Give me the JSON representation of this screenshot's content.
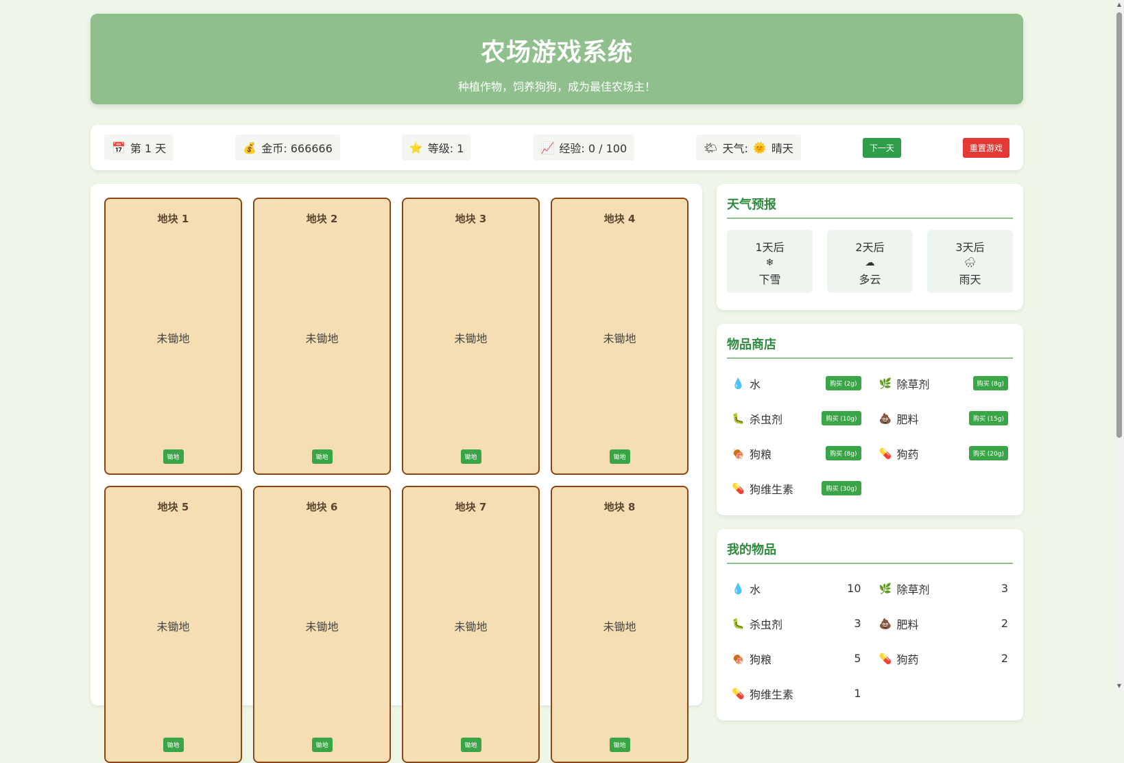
{
  "header": {
    "title": "农场游戏系统",
    "subtitle": "种植作物，饲养狗狗，成为最佳农场主！"
  },
  "status": {
    "day": "第 1 天",
    "gold": "金币: 666666",
    "level": "等级: 1",
    "exp": "经验: 0 / 100",
    "weather_label": "天气:",
    "weather_value": "晴天",
    "next_day_button": "下一天",
    "reset_button": "重置游戏"
  },
  "plots": [
    {
      "title": "地块 1",
      "state": "未锄地",
      "action": "锄地"
    },
    {
      "title": "地块 2",
      "state": "未锄地",
      "action": "锄地"
    },
    {
      "title": "地块 3",
      "state": "未锄地",
      "action": "锄地"
    },
    {
      "title": "地块 4",
      "state": "未锄地",
      "action": "锄地"
    },
    {
      "title": "地块 5",
      "state": "未锄地",
      "action": "锄地"
    },
    {
      "title": "地块 6",
      "state": "未锄地",
      "action": "锄地"
    },
    {
      "title": "地块 7",
      "state": "未锄地",
      "action": "锄地"
    },
    {
      "title": "地块 8",
      "state": "未锄地",
      "action": "锄地"
    }
  ],
  "forecast": {
    "title": "天气预报",
    "days": [
      {
        "when": "1天后",
        "icon": "snowflake-icon",
        "glyph": "❄",
        "label": "下雪"
      },
      {
        "when": "2天后",
        "icon": "cloud-icon",
        "glyph": "☁",
        "label": "多云"
      },
      {
        "when": "3天后",
        "icon": "rain-cloud-icon",
        "glyph": "🌧",
        "label": "雨天"
      }
    ]
  },
  "shop": {
    "title": "物品商店",
    "items": [
      {
        "name": "水",
        "icon": "water-drop-icon",
        "glyph": "💧",
        "buy": "购买 (2g)"
      },
      {
        "name": "除草剂",
        "icon": "herb-icon",
        "glyph": "🌿",
        "buy": "购买 (8g)"
      },
      {
        "name": "杀虫剂",
        "icon": "bug-icon",
        "glyph": "🐛",
        "buy": "购买 (10g)"
      },
      {
        "name": "肥料",
        "icon": "poop-icon",
        "glyph": "💩",
        "buy": "购买 (15g)"
      },
      {
        "name": "狗粮",
        "icon": "meat-icon",
        "glyph": "🍖",
        "buy": "购买 (8g)"
      },
      {
        "name": "狗药",
        "icon": "pill-icon",
        "glyph": "💊",
        "buy": "购买 (20g)"
      },
      {
        "name": "狗维生素",
        "icon": "pill-icon",
        "glyph": "💊",
        "buy": "购买 (30g)"
      }
    ]
  },
  "inventory": {
    "title": "我的物品",
    "items": [
      {
        "name": "水",
        "icon": "water-drop-icon",
        "glyph": "💧",
        "count": "10"
      },
      {
        "name": "除草剂",
        "icon": "herb-icon",
        "glyph": "🌿",
        "count": "3"
      },
      {
        "name": "杀虫剂",
        "icon": "bug-icon",
        "glyph": "🐛",
        "count": "3"
      },
      {
        "name": "肥料",
        "icon": "poop-icon",
        "glyph": "💩",
        "count": "2"
      },
      {
        "name": "狗粮",
        "icon": "meat-icon",
        "glyph": "🍖",
        "count": "5"
      },
      {
        "name": "狗药",
        "icon": "pill-icon",
        "glyph": "💊",
        "count": "2"
      },
      {
        "name": "狗维生素",
        "icon": "pill-icon",
        "glyph": "💊",
        "count": "1"
      }
    ]
  }
}
